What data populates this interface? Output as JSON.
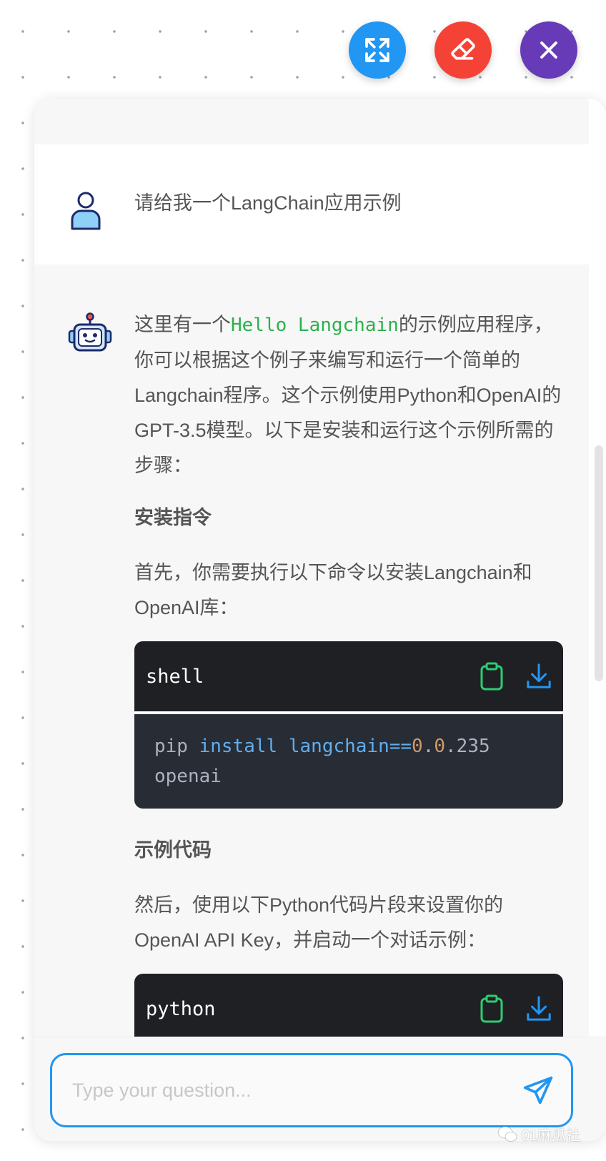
{
  "toolbar": {
    "expand_icon": "expand-arrows-icon",
    "clear_icon": "eraser-icon",
    "close_icon": "close-icon",
    "colors": {
      "expand": "#2196f3",
      "clear": "#f44336",
      "close": "#673ab7"
    }
  },
  "conversation": {
    "user_message": "请给我一个LangChain应用示例",
    "bot": {
      "intro_pre": "这里有一个",
      "intro_code": "Hello Langchain",
      "intro_post": "的示例应用程序，你可以根据这个例子来编写和运行一个简单的Langchain程序。这个示例使用Python和OpenAI的GPT-3.5模型。以下是安装和运行这个示例所需的步骤：",
      "heading_install": "安装指令",
      "install_text": "首先，你需要执行以下命令以安装Langchain和OpenAI库：",
      "code1": {
        "lang": "shell",
        "tok_pip": "pip ",
        "tok_install": "install",
        "tok_space": " ",
        "tok_langchain": "langchain==",
        "tok_v1": "0",
        "tok_dot1": ".",
        "tok_v2": "0",
        "tok_rest": ".235",
        "line2": "openai"
      },
      "heading_code": "示例代码",
      "code_text": "然后，使用以下Python代码片段来设置你的OpenAI API Key，并启动一个对话示例：",
      "code2": {
        "lang": "python"
      }
    }
  },
  "input": {
    "placeholder": "Type your question...",
    "value": ""
  },
  "watermark": "01麻瓜社"
}
